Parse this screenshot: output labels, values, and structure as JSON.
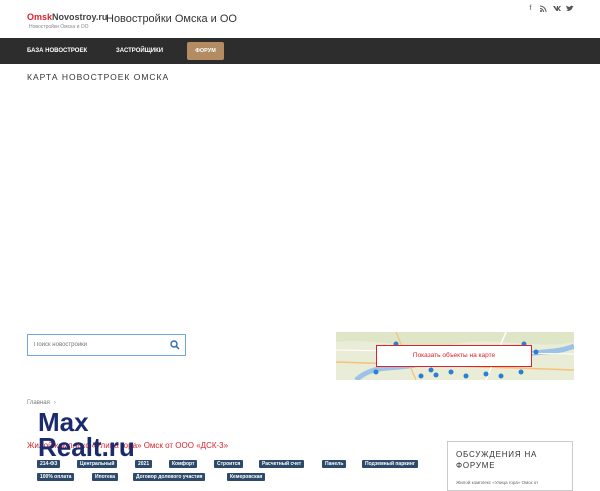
{
  "header": {
    "logo_part1": "Omsk",
    "logo_part2": "Novostroy.ru",
    "logo_tagline": "Новостройки Омска и ОО",
    "site_title": "Новостройки Омска и ОО",
    "social_icons": [
      "facebook-icon",
      "rss-icon",
      "vk-icon",
      "twitter-icon"
    ]
  },
  "nav": {
    "items": [
      "БАЗА НОВОСТРОЕК",
      "ЗАСТРОЙЩИКИ"
    ],
    "forum": "ФОРУМ"
  },
  "map_section": {
    "title": "КАРТА НОВОСТРОЕК ОМСКА"
  },
  "search": {
    "placeholder": "Поиск новостройки"
  },
  "mini_map": {
    "button_label": "Показать объекты на карте"
  },
  "breadcrumb": {
    "home": "Главная"
  },
  "article": {
    "title": "Жилой комплекс «Улица гора» Омск от ООО «ДСК-3»",
    "tags": [
      "214-ФЗ",
      "Центральный",
      "2021",
      "Комфорт",
      "Строится",
      "Расчетный счет",
      "Панель",
      "Подземный паркинг",
      "100% оплата",
      "Ипотека",
      "Договор долевого участия",
      "Кемеровская"
    ]
  },
  "sidebar": {
    "title": "ОБСУЖДЕНИЯ НА ФОРУМЕ",
    "sub": "Жилой комплекс «Улица гора» Омск от"
  },
  "watermark": {
    "line1": "Max",
    "line2": "Realt.ru"
  },
  "colors": {
    "accent_red": "#d9232d",
    "navbar": "#2d2d2d",
    "forum_btn": "#b48c64",
    "tag_bg": "#2d4a6b"
  }
}
